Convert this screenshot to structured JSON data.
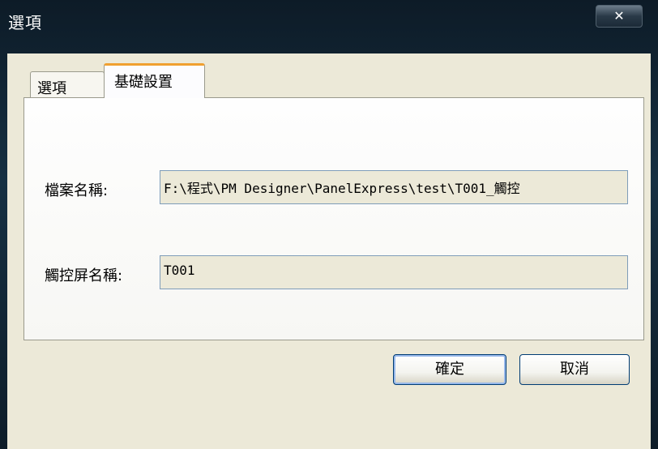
{
  "window": {
    "title": "選項",
    "close_label": "✕"
  },
  "tabs": [
    {
      "label": "選項",
      "selected": false
    },
    {
      "label": "基礎設置",
      "selected": true
    }
  ],
  "fields": {
    "file_name": {
      "label": "檔案名稱:",
      "value": "F:\\程式\\PM Designer\\PanelExpress\\test\\T001_觸控"
    },
    "screen_name": {
      "label": "觸控屏名稱:",
      "value": "T001"
    }
  },
  "buttons": {
    "ok": "確定",
    "cancel": "取消"
  }
}
